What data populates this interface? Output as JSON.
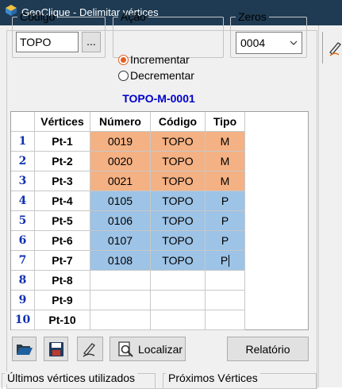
{
  "window": {
    "title": "GeoClique - Delimitar vértices"
  },
  "codigo": {
    "legend": "Código",
    "value": "TOPO",
    "browse_label": "..."
  },
  "acao": {
    "legend": "Ação",
    "options": [
      {
        "label": "Incrementar",
        "checked": true
      },
      {
        "label": "Decrementar",
        "checked": false
      }
    ]
  },
  "zeros": {
    "legend": "Zeros",
    "value": "0004"
  },
  "preview_code": "TOPO-M-0001",
  "grid": {
    "headers": [
      "Vértices",
      "Número",
      "Código",
      "Tipo"
    ],
    "rows": [
      {
        "index": "1",
        "vertice": "Pt-1",
        "numero": "0019",
        "codigo": "TOPO",
        "tipo": "M",
        "color": "orange"
      },
      {
        "index": "2",
        "vertice": "Pt-2",
        "numero": "0020",
        "codigo": "TOPO",
        "tipo": "M",
        "color": "orange"
      },
      {
        "index": "3",
        "vertice": "Pt-3",
        "numero": "0021",
        "codigo": "TOPO",
        "tipo": "M",
        "color": "orange"
      },
      {
        "index": "4",
        "vertice": "Pt-4",
        "numero": "0105",
        "codigo": "TOPO",
        "tipo": "P",
        "color": "blue"
      },
      {
        "index": "5",
        "vertice": "Pt-5",
        "numero": "0106",
        "codigo": "TOPO",
        "tipo": "P",
        "color": "blue"
      },
      {
        "index": "6",
        "vertice": "Pt-6",
        "numero": "0107",
        "codigo": "TOPO",
        "tipo": "P",
        "color": "blue"
      },
      {
        "index": "7",
        "vertice": "Pt-7",
        "numero": "0108",
        "codigo": "TOPO",
        "tipo": "P",
        "color": "blue"
      },
      {
        "index": "8",
        "vertice": "Pt-8",
        "numero": "",
        "codigo": "",
        "tipo": "",
        "color": "none"
      },
      {
        "index": "9",
        "vertice": "Pt-9",
        "numero": "",
        "codigo": "",
        "tipo": "",
        "color": "none"
      },
      {
        "index": "10",
        "vertice": "Pt-10",
        "numero": "",
        "codigo": "",
        "tipo": "",
        "color": "none"
      }
    ]
  },
  "toolbar": {
    "open_icon": "folder-open-icon",
    "save_icon": "floppy-disk-icon",
    "draw_icon": "pen-draw-icon",
    "locate_icon": "magnifier-document-icon",
    "locate_label": "Localizar",
    "report_label": "Relatório"
  },
  "bottom": {
    "last_used_label": "Últimos vértices utilizados",
    "next_label": "Próximos Vértices"
  },
  "colors": {
    "title_bar": "#1f3b53",
    "orange_row": "#f4b183",
    "blue_row": "#9dc3e6",
    "preview_text": "#0000cc",
    "index_text": "#1030b0"
  }
}
